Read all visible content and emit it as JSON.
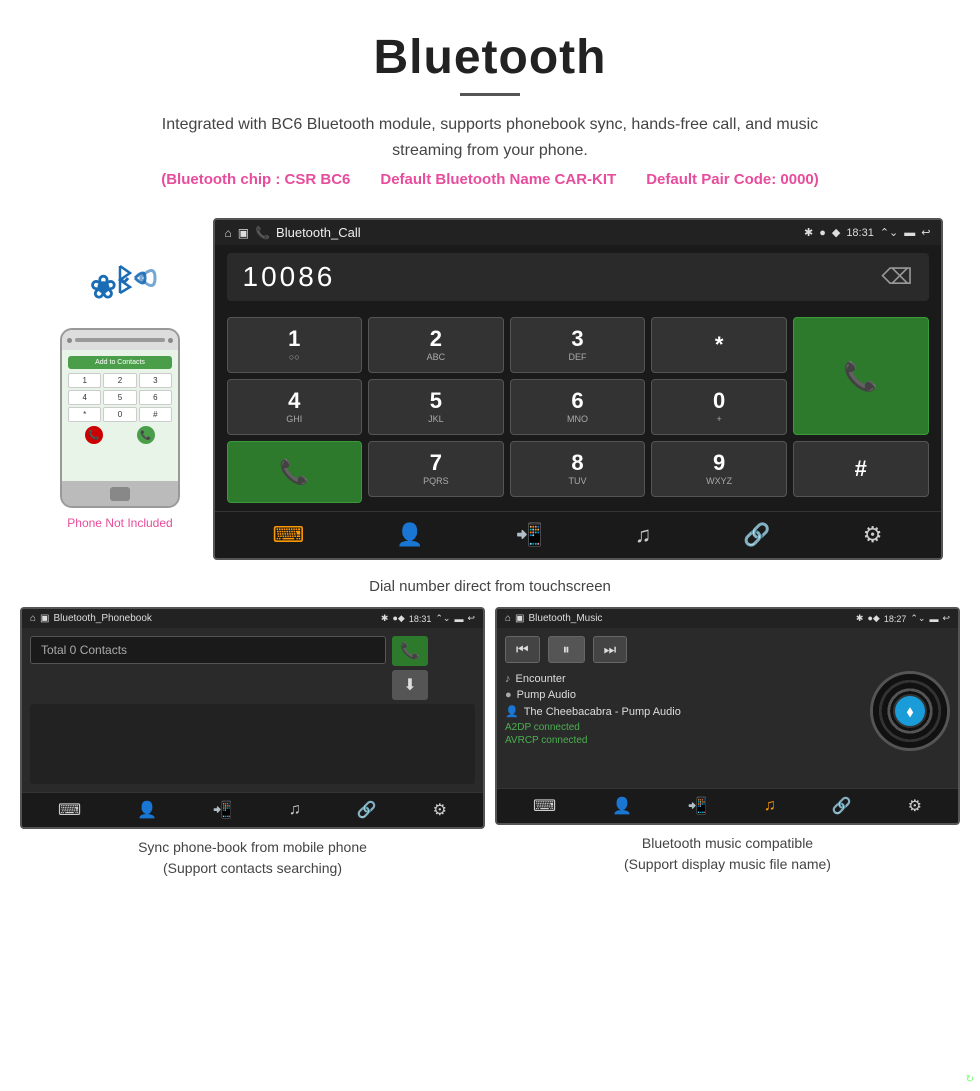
{
  "header": {
    "title": "Bluetooth",
    "description": "Integrated with BC6 Bluetooth module, supports phonebook sync, hands-free call, and music streaming from your phone.",
    "specs": [
      "(Bluetooth chip : CSR BC6",
      "Default Bluetooth Name CAR-KIT",
      "Default Pair Code: 0000)"
    ]
  },
  "phone": {
    "not_included": "Phone Not Included",
    "add_contact": "Add to Contacts",
    "keys": [
      "1",
      "2",
      "3",
      "4",
      "5",
      "6",
      "*",
      "0",
      "#"
    ]
  },
  "dial_screen": {
    "status": {
      "app_name": "Bluetooth_Call",
      "time": "18:31",
      "icons": [
        "home",
        "window",
        "phone",
        "bluetooth",
        "signal",
        "battery",
        "back",
        "menu"
      ]
    },
    "number": "10086",
    "keys": [
      {
        "main": "1",
        "sub": "○○"
      },
      {
        "main": "2",
        "sub": "ABC"
      },
      {
        "main": "3",
        "sub": "DEF"
      },
      {
        "main": "*",
        "sub": ""
      },
      {
        "main": "call",
        "sub": ""
      },
      {
        "main": "4",
        "sub": "GHI"
      },
      {
        "main": "5",
        "sub": "JKL"
      },
      {
        "main": "6",
        "sub": "MNO"
      },
      {
        "main": "0",
        "sub": "+"
      },
      {
        "main": "",
        "sub": ""
      },
      {
        "main": "7",
        "sub": "PQRS"
      },
      {
        "main": "8",
        "sub": "TUV"
      },
      {
        "main": "9",
        "sub": "WXYZ"
      },
      {
        "main": "#",
        "sub": ""
      },
      {
        "main": "recall",
        "sub": ""
      }
    ],
    "bottom_icons": [
      "keypad",
      "contacts",
      "call-transfer",
      "music",
      "link",
      "settings"
    ]
  },
  "dial_caption": "Dial number direct from touchscreen",
  "phonebook_screen": {
    "status": {
      "app_name": "Bluetooth_Phonebook",
      "time": "18:31"
    },
    "search_placeholder": "Total 0 Contacts",
    "caption_line1": "Sync phone-book from mobile phone",
    "caption_line2": "(Support contacts searching)"
  },
  "music_screen": {
    "status": {
      "app_name": "Bluetooth_Music",
      "time": "18:27"
    },
    "tracks": [
      {
        "icon": "♪",
        "label": "Encounter"
      },
      {
        "icon": "●",
        "label": "Pump Audio"
      },
      {
        "icon": "👤",
        "label": "The Cheebacabra - Pump Audio"
      }
    ],
    "connected_status": [
      "A2DP connected",
      "AVRCP connected"
    ],
    "caption_line1": "Bluetooth music compatible",
    "caption_line2": "(Support display music file name)"
  }
}
